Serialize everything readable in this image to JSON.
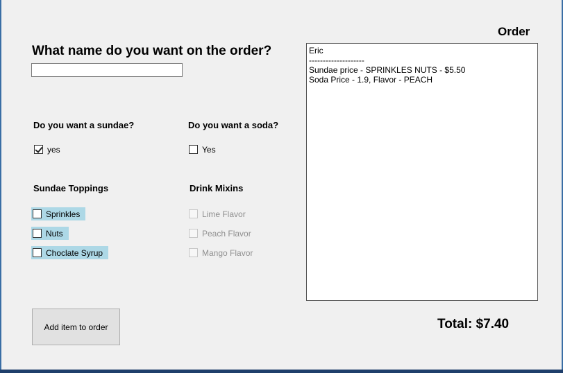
{
  "name_section": {
    "question": "What name do you want on the order?",
    "input_value": ""
  },
  "sundae": {
    "question": "Do you want a sundae?",
    "checkbox_label": "yes",
    "checked": true
  },
  "soda": {
    "question": "Do you want a soda?",
    "checkbox_label": "Yes",
    "checked": false
  },
  "toppings": {
    "title": "Sundae Toppings",
    "items": [
      {
        "label": "Sprinkles",
        "checked": false
      },
      {
        "label": "Nuts",
        "checked": false
      },
      {
        "label": "Choclate Syrup",
        "checked": false
      }
    ]
  },
  "mixins": {
    "title": "Drink Mixins",
    "items": [
      {
        "label": "Lime Flavor",
        "checked": false,
        "enabled": false
      },
      {
        "label": "Peach Flavor",
        "checked": false,
        "enabled": false
      },
      {
        "label": "Mango Flavor",
        "checked": false,
        "enabled": false
      }
    ]
  },
  "order": {
    "title": "Order",
    "lines": [
      "Eric",
      "--------------------",
      "Sundae price - SPRINKLES NUTS - $5.50",
      "Soda Price - 1.9, Flavor - PEACH"
    ]
  },
  "total_label": "Total: $7.40",
  "add_button_label": "Add item to order",
  "colors": {
    "window_background": "#f0f0f0",
    "highlight": "#add8e6",
    "frame_border": "#3a6ea5"
  }
}
